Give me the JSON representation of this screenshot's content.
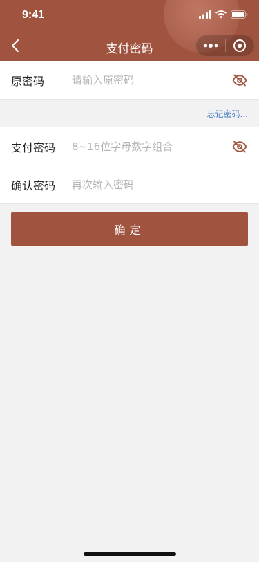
{
  "status_bar": {
    "time": "9:41"
  },
  "nav": {
    "title": "支付密码"
  },
  "form": {
    "original": {
      "label": "原密码",
      "placeholder": "请输入原密码",
      "value": ""
    },
    "forgot_link": "忘记密码...",
    "new": {
      "label": "支付密码",
      "placeholder": "8~16位字母数字组合",
      "value": ""
    },
    "confirm": {
      "label": "确认密码",
      "placeholder": "再次输入密码",
      "value": ""
    }
  },
  "actions": {
    "submit_label": "确定"
  },
  "colors": {
    "brand": "#a0533f",
    "link": "#4a7cc4",
    "background": "#f2f2f2"
  },
  "icons": {
    "back": "chevron-left-icon",
    "more": "more-dots-icon",
    "close": "target-circle-icon",
    "eye": "eye-off-icon"
  }
}
